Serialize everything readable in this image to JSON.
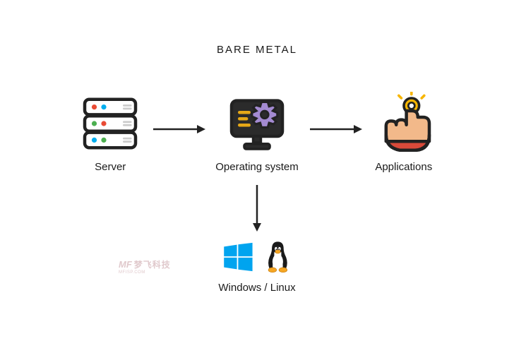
{
  "title": "BARE METAL",
  "nodes": {
    "server": {
      "label": "Server"
    },
    "os": {
      "label": "Operating system"
    },
    "apps": {
      "label": "Applications"
    }
  },
  "os_examples": {
    "label": "Windows / Linux"
  },
  "watermark": {
    "main": "梦飞科技",
    "sub": "MFISP.COM",
    "prefix": "MF"
  },
  "colors": {
    "outline": "#222222",
    "accent_blue": "#00AEEF",
    "accent_red": "#E94B35",
    "accent_green": "#4CAF50",
    "gear": "#A48BD1",
    "monitor_dark": "#2B2B2B",
    "menu_yellow": "#E6A817",
    "skin": "#F2B98A",
    "cuff": "#D94A3A",
    "spark_yellow": "#F7B500",
    "windows_blue": "#00A4EF",
    "penguin_black": "#1A1A1A",
    "penguin_beak": "#F5A623"
  }
}
